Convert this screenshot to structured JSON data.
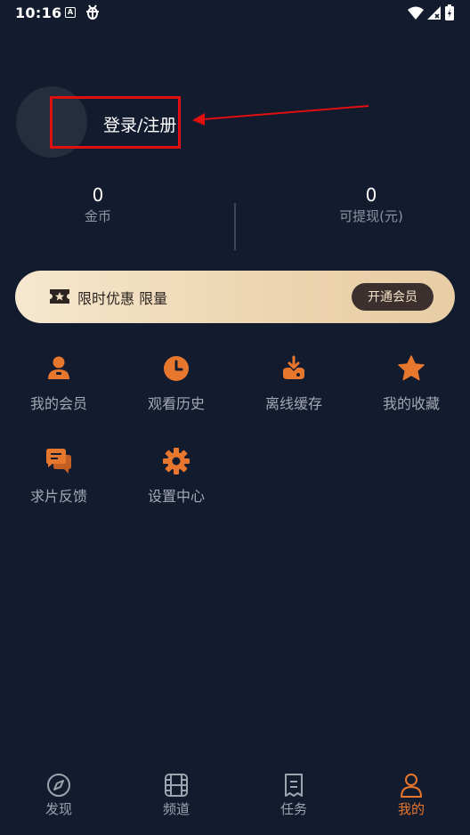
{
  "status_bar": {
    "time": "10:16",
    "a_icon_letter": "A",
    "icons": [
      "a-icon",
      "bug-icon",
      "wifi-icon",
      "signal-icon",
      "battery-icon"
    ]
  },
  "profile": {
    "login_label": "登录/注册"
  },
  "stats": {
    "coins": {
      "value": "0",
      "label": "金币"
    },
    "cash": {
      "value": "0",
      "label": "可提现(元)"
    }
  },
  "vip_banner": {
    "text": "限时优惠 限量",
    "button_label": "开通会员"
  },
  "grid": {
    "items": [
      {
        "label": "我的会员",
        "icon": "member-icon"
      },
      {
        "label": "观看历史",
        "icon": "clock-icon"
      },
      {
        "label": "离线缓存",
        "icon": "download-icon"
      },
      {
        "label": "我的收藏",
        "icon": "star-icon"
      },
      {
        "label": "求片反馈",
        "icon": "chat-icon"
      },
      {
        "label": "设置中心",
        "icon": "gear-icon"
      }
    ]
  },
  "bottom_nav": {
    "items": [
      {
        "label": "发现",
        "icon": "compass-icon",
        "active": false
      },
      {
        "label": "频道",
        "icon": "film-icon",
        "active": false
      },
      {
        "label": "任务",
        "icon": "task-icon",
        "active": false
      },
      {
        "label": "我的",
        "icon": "person-icon",
        "active": true
      }
    ]
  },
  "colors": {
    "background": "#131b2e",
    "accent": "#e8772e",
    "annotation": "#e01010",
    "vip_gold": "#ecd4ae",
    "vip_button": "#3b302d"
  }
}
